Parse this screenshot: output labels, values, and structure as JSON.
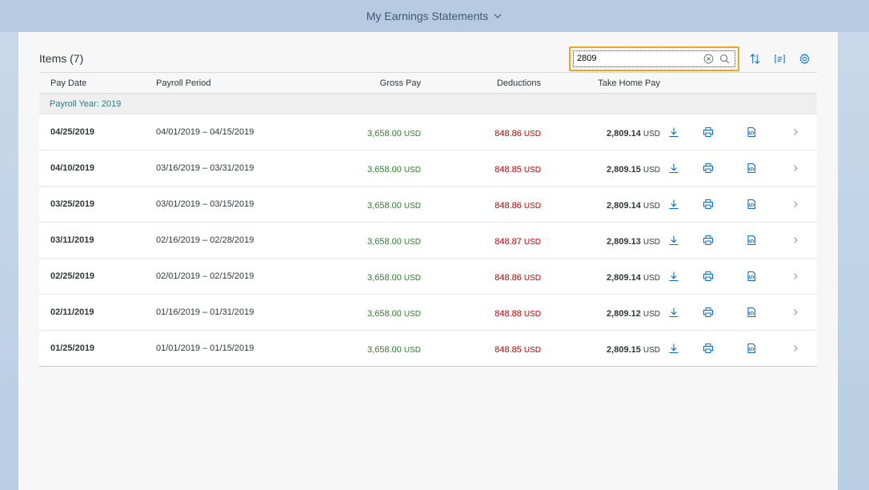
{
  "header": {
    "app_title": "My Earnings Statements"
  },
  "toolbar": {
    "items_title": "Items (7)",
    "search_value": "2809"
  },
  "columns": {
    "pay_date": "Pay Date",
    "payroll_period": "Payroll Period",
    "gross_pay": "Gross Pay",
    "deductions": "Deductions",
    "take_home_pay": "Take Home Pay"
  },
  "group": {
    "label": "Payroll Year: 2019"
  },
  "currency": "USD",
  "rows": [
    {
      "pay_date": "04/25/2019",
      "period": "04/01/2019 – 04/15/2019",
      "gross": "3,658.00",
      "deductions": "848.86",
      "take_home": "2,809.14"
    },
    {
      "pay_date": "04/10/2019",
      "period": "03/16/2019 – 03/31/2019",
      "gross": "3,658.00",
      "deductions": "848.85",
      "take_home": "2,809.15"
    },
    {
      "pay_date": "03/25/2019",
      "period": "03/01/2019 – 03/15/2019",
      "gross": "3,658.00",
      "deductions": "848.86",
      "take_home": "2,809.14"
    },
    {
      "pay_date": "03/11/2019",
      "period": "02/16/2019 – 02/28/2019",
      "gross": "3,658.00",
      "deductions": "848.87",
      "take_home": "2,809.13"
    },
    {
      "pay_date": "02/25/2019",
      "period": "02/01/2019 – 02/15/2019",
      "gross": "3,658.00",
      "deductions": "848.86",
      "take_home": "2,809.14"
    },
    {
      "pay_date": "02/11/2019",
      "period": "01/16/2019 – 01/31/2019",
      "gross": "3,658.00",
      "deductions": "848.88",
      "take_home": "2,809.12"
    },
    {
      "pay_date": "01/25/2019",
      "period": "01/01/2019 – 01/15/2019",
      "gross": "3,658.00",
      "deductions": "848.85",
      "take_home": "2,809.15"
    }
  ],
  "colors": {
    "gross": "#2b7d2b",
    "deductions": "#bb0000",
    "group_label": "#2b7c7c",
    "icon": "#0a6ed1",
    "search_highlight": "#e9a727"
  },
  "icons": {
    "title_menu": "chevron-down-icon",
    "search_clear": "clear-circle-icon",
    "search": "search-icon",
    "sort": "sort-icon",
    "group": "group-icon",
    "settings": "gear-icon",
    "row_download": "download-icon",
    "row_print": "print-icon",
    "row_xml": "xml-document-icon",
    "row_nav": "chevron-right-icon"
  }
}
